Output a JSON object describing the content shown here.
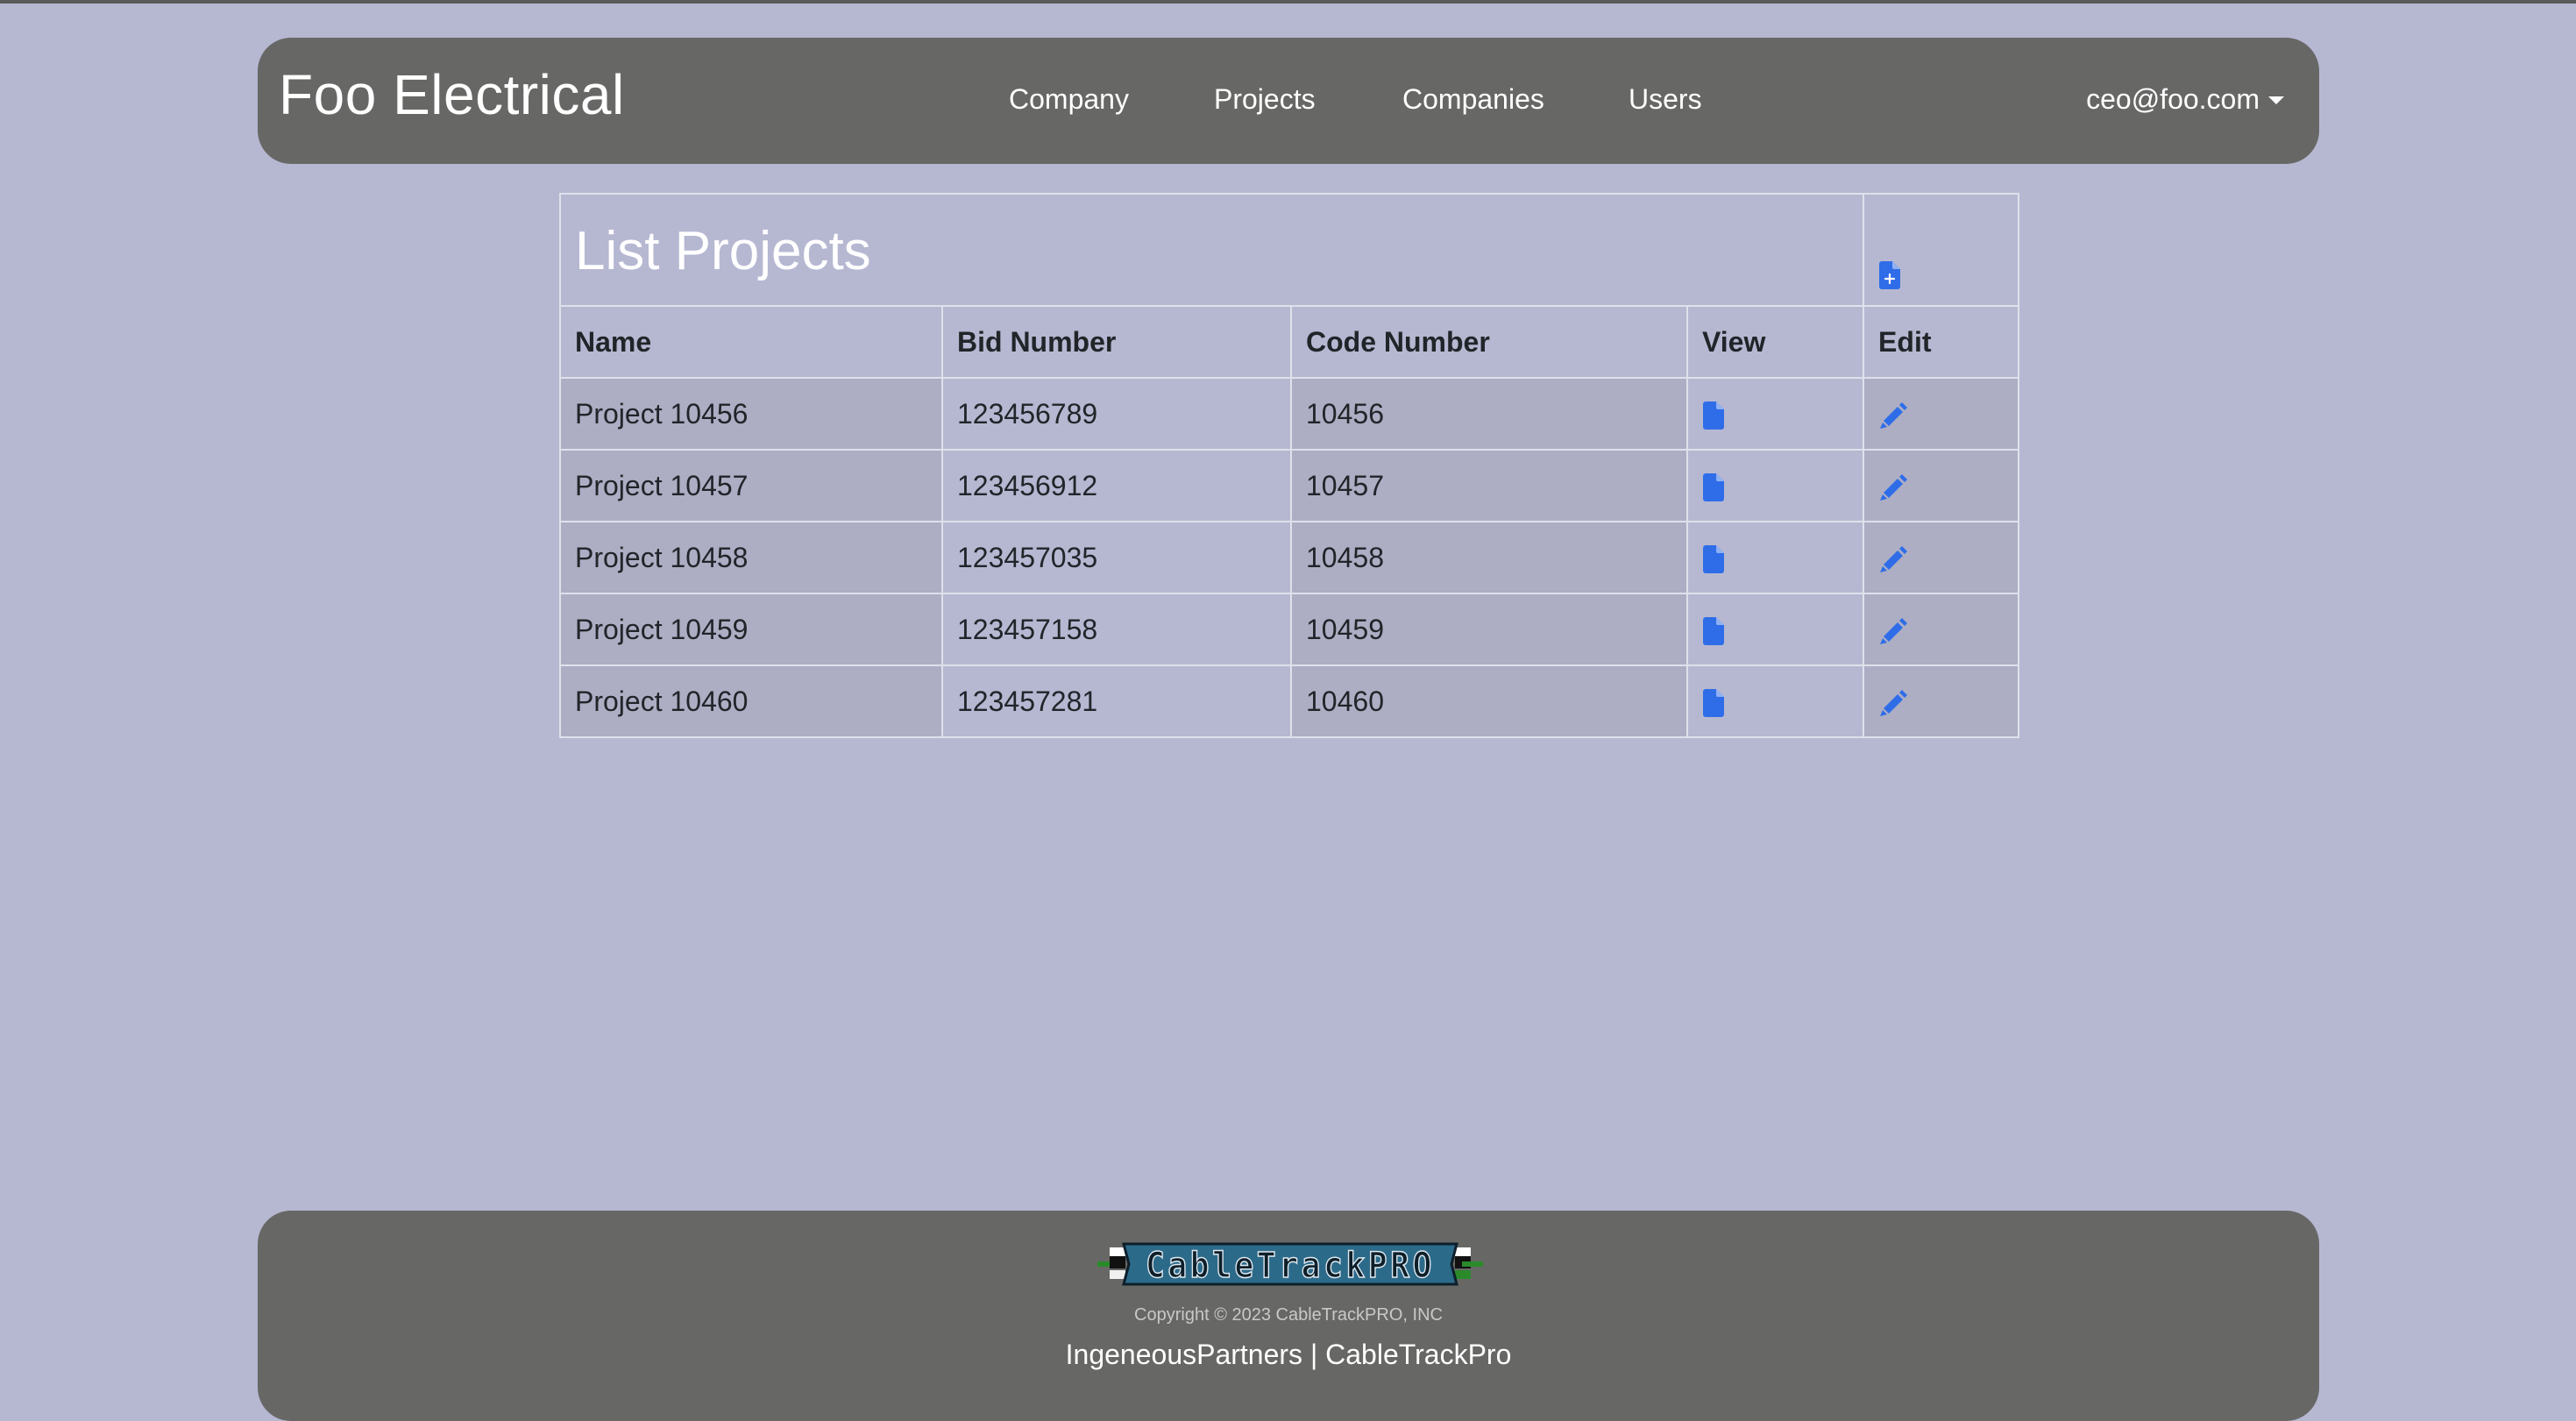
{
  "navbar": {
    "brand": "Foo Electrical",
    "links": [
      "Company",
      "Projects",
      "Companies",
      "Users"
    ],
    "user_email": "ceo@foo.com"
  },
  "page": {
    "title": "List Projects"
  },
  "table": {
    "headers": [
      "Name",
      "Bid Number",
      "Code Number",
      "View",
      "Edit"
    ],
    "rows": [
      {
        "name": "Project 10456",
        "bid": "123456789",
        "code": "10456"
      },
      {
        "name": "Project 10457",
        "bid": "123456912",
        "code": "10457"
      },
      {
        "name": "Project 10458",
        "bid": "123457035",
        "code": "10458"
      },
      {
        "name": "Project 10459",
        "bid": "123457158",
        "code": "10459"
      },
      {
        "name": "Project 10460",
        "bid": "123457281",
        "code": "10460"
      }
    ],
    "icons": {
      "new": "file-plus-icon",
      "view": "file-icon",
      "edit": "pencil-icon"
    }
  },
  "footer": {
    "logo_text": "CableTrackPRO",
    "copyright": "Copyright © 2023 CableTrackPRO, INC",
    "link_1": "IngeneousPartners",
    "separator": "|",
    "link_2": "CableTrackPro"
  },
  "colors": {
    "background": "#b6b8d2",
    "bar": "#676866",
    "icon_blue": "#2f6de8"
  }
}
